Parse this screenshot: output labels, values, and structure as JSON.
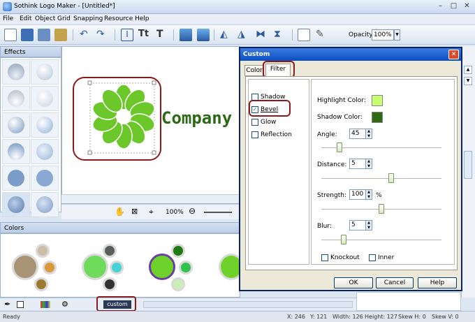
{
  "window": {
    "title": "Sothink Logo Maker - [Untitled*]"
  },
  "menu": [
    "File",
    "Edit",
    "Object",
    "Grid",
    "Snapping",
    "Resource",
    "Help"
  ],
  "toolbar": {
    "opacity_label": "Opacity:",
    "opacity_value": "100%"
  },
  "effects": {
    "title": "Effects"
  },
  "canvas": {
    "company_text": "Company",
    "zoom": "100%"
  },
  "colors": {
    "title": "Colors",
    "accent": "#6fd22a"
  },
  "bottom": {
    "custom_label": "custom"
  },
  "status": {
    "ready": "Ready",
    "x": "X: 246",
    "y": "Y: 121",
    "width": "Width: 126",
    "height": "Height: 127",
    "skew_h": "Skew H: 0",
    "skew_v": "Skew V: 0"
  },
  "dialog": {
    "title": "Custom",
    "tabs": [
      "Color",
      "Filter"
    ],
    "effects": [
      {
        "label": "Shadow",
        "checked": false
      },
      {
        "label": "Bevel",
        "checked": true
      },
      {
        "label": "Glow",
        "checked": false
      },
      {
        "label": "Reflection",
        "checked": false
      }
    ],
    "highlight_label": "Highlight Color:",
    "highlight_color": "#c8ff6e",
    "shadow_label": "Shadow Color:",
    "shadow_color": "#2f6a12",
    "angle_label": "Angle:",
    "angle_value": "45",
    "distance_label": "Distance:",
    "distance_value": "5",
    "strength_label": "Strength:",
    "strength_value": "100",
    "strength_unit": "%",
    "blur_label": "Blur:",
    "blur_value": "5",
    "knockout_label": "Knockout",
    "inner_label": "Inner",
    "ok": "OK",
    "cancel": "Cancel",
    "help": "Help"
  }
}
